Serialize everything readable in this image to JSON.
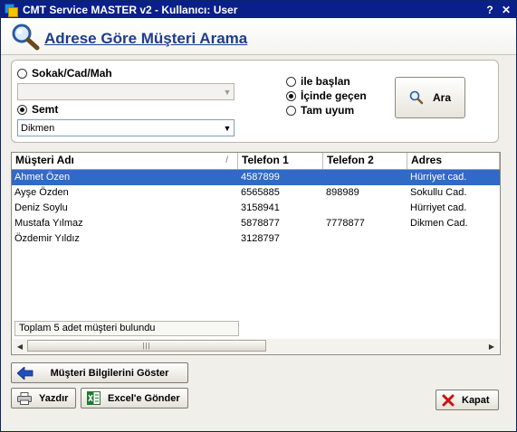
{
  "window": {
    "title": "CMT Service MASTER v2  -   Kullanıcı: User",
    "help_glyph": "?",
    "close_glyph": "✕"
  },
  "header": {
    "title": "Adrese Göre Müşteri Arama",
    "icon": "magnifier-icon"
  },
  "search": {
    "sokak_label": "Sokak/Cad/Mah",
    "sokak_value": "",
    "semt_label": "Semt",
    "semt_value": "Dikmen",
    "selected_field": "Semt",
    "match_options": [
      {
        "label": "ile başlan",
        "checked": false
      },
      {
        "label": "İçinde geçen",
        "checked": true
      },
      {
        "label": "Tam uyum",
        "checked": false
      }
    ],
    "search_button": "Ara"
  },
  "grid": {
    "columns": [
      "Müşteri Adı",
      "Telefon 1",
      "Telefon 2",
      "Adres"
    ],
    "sort_indicator": "/",
    "rows": [
      {
        "name": "Ahmet Özen",
        "tel1": "4587899",
        "tel2": "",
        "address": "Hürriyet cad.",
        "selected": true
      },
      {
        "name": "Ayşe Özden",
        "tel1": "6565885",
        "tel2": "898989",
        "address": "Sokullu Cad.",
        "selected": false
      },
      {
        "name": "Deniz Soylu",
        "tel1": "3158941",
        "tel2": "",
        "address": "Hürriyet cad.",
        "selected": false
      },
      {
        "name": "Mustafa Yılmaz",
        "tel1": "5878877",
        "tel2": "7778877",
        "address": "Dikmen Cad.",
        "selected": false
      },
      {
        "name": "Özdemir Yıldız",
        "tel1": "3128797",
        "tel2": "",
        "address": "",
        "selected": false
      }
    ],
    "status_text": "Toplam 5 adet müşteri bulundu",
    "scroll_grip": "|||"
  },
  "buttons": {
    "show_details": "Müşteri Bilgilerini Göster",
    "print": "Yazdır",
    "excel": "Excel'e Gönder",
    "close": "Kapat"
  },
  "colors": {
    "title_bar": "#0a1f8a",
    "header_title": "#1f3c8f",
    "selection": "#3169c6",
    "close_x": "#cc1111"
  }
}
